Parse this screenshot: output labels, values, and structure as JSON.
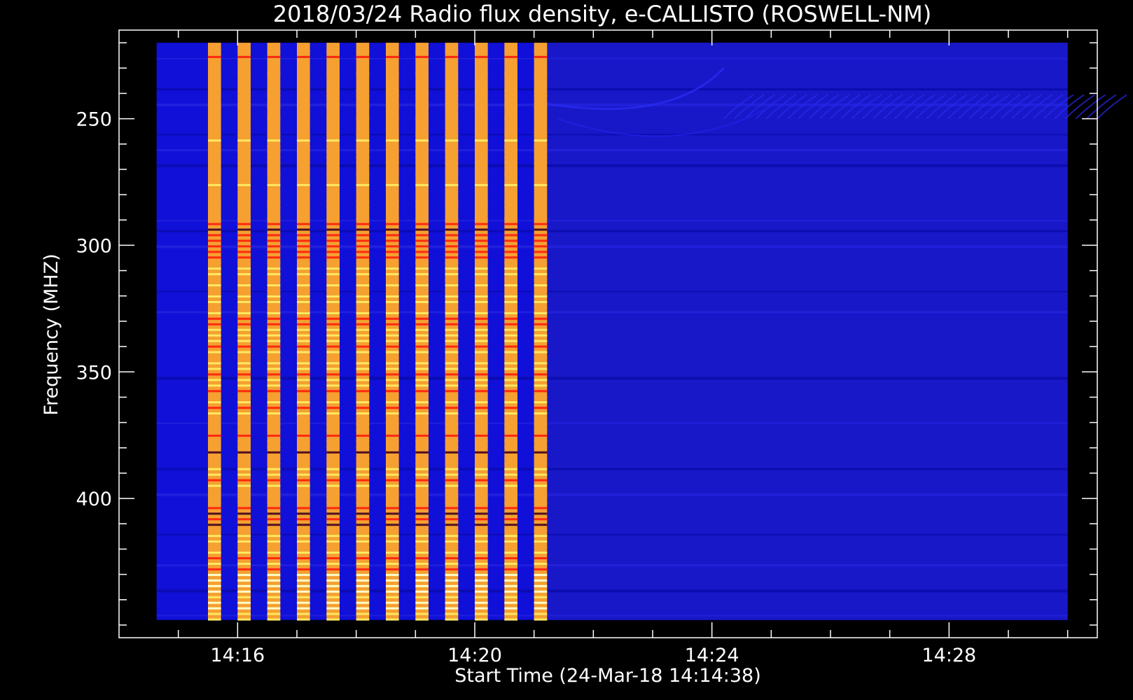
{
  "chart_data": {
    "type": "heatmap",
    "title": "2018/03/24  Radio flux density, e-CALLISTO (ROSWELL-NM)",
    "xlabel": "Start Time (24-Mar-18 14:14:38)",
    "ylabel": "Frequency (MHZ)",
    "x_start": "14:14:38",
    "x_end": "14:30:00",
    "xlim_minutes": [
      14.0,
      30.5
    ],
    "ylim": [
      215,
      455
    ],
    "y_inverted": true,
    "xticks": [
      {
        "minutes": 16,
        "label": "14:16"
      },
      {
        "minutes": 20,
        "label": "14:20"
      },
      {
        "minutes": 24,
        "label": "14:24"
      },
      {
        "minutes": 28,
        "label": "14:28"
      }
    ],
    "x_minor_tick_step_minutes": 1,
    "yticks": [
      {
        "value": 250,
        "label": "250"
      },
      {
        "value": 300,
        "label": "300"
      },
      {
        "value": 350,
        "label": "350"
      },
      {
        "value": 400,
        "label": "400"
      }
    ],
    "y_minor_tick_step": 10,
    "data_extent": {
      "time_start": "14:14:38",
      "time_end": "14:30:00",
      "freq_min": 220,
      "freq_max": 448
    },
    "bursts": {
      "description_values": "periodic broadband emission stripes",
      "start_minutes": 15.5,
      "period_minutes": 0.5,
      "count": 12,
      "width_minutes": 0.22,
      "end_minutes": 21.0
    },
    "background_level": "low",
    "colors": {
      "background": "#1010d8",
      "background_right": "#1818c8",
      "burst_base": "#f5a030",
      "burst_red": "#ff2a10",
      "burst_yellow": "#ffe860",
      "burst_white": "#ffffc8",
      "burst_dark": "#501020"
    }
  }
}
